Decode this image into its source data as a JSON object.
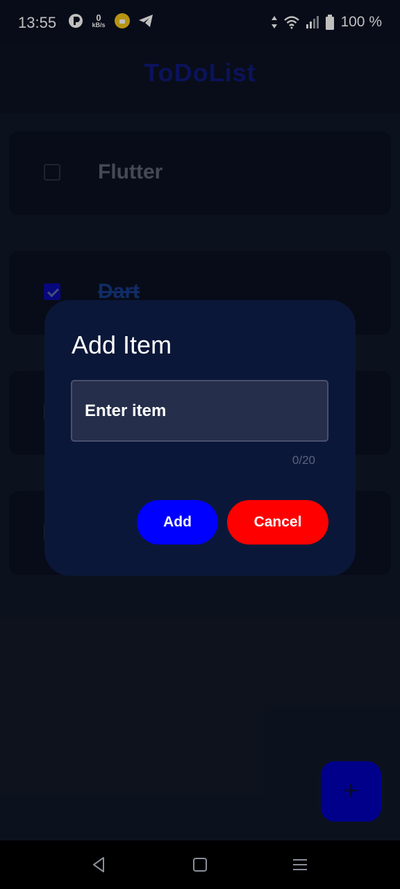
{
  "status_bar": {
    "time": "13:55",
    "net_speed_value": "0",
    "net_speed_unit": "kB/s",
    "battery": "100 %",
    "icons": [
      "p-app-icon",
      "net-speed-icon",
      "notification-app-icon",
      "telegram-icon",
      "data-arrows-icon",
      "wifi-icon",
      "signal-icon",
      "battery-icon"
    ]
  },
  "app_bar": {
    "title": "ToDoList"
  },
  "todo_items": [
    {
      "label": "Flutter",
      "checked": false
    },
    {
      "label": "Dart",
      "checked": true
    }
  ],
  "dialog": {
    "title": "Add Item",
    "input_value": "",
    "input_placeholder": "Enter item",
    "counter": "0/20",
    "add_label": "Add",
    "cancel_label": "Cancel"
  },
  "fab": {
    "icon": "plus-icon"
  },
  "nav_bar": {
    "icons": [
      "back-icon",
      "home-icon",
      "menu-icon"
    ]
  },
  "colors": {
    "add_button": "#0000ff",
    "cancel_button": "#ff0000",
    "dialog_bg": "#0b1738",
    "fab": "#0000b8"
  }
}
